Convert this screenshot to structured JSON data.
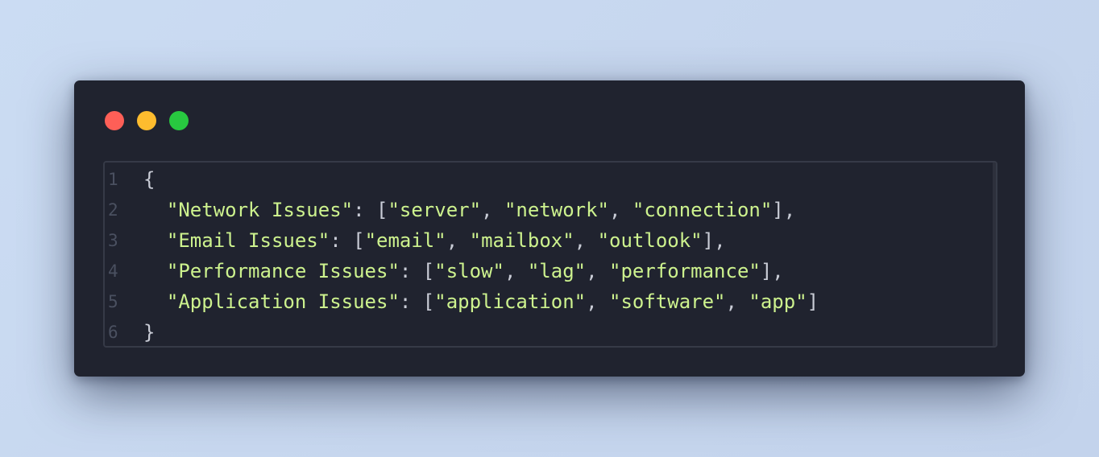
{
  "window": {
    "controls": {
      "close_color": "#fe5f57",
      "minimize_color": "#febc2e",
      "maximize_color": "#28c840"
    }
  },
  "editor": {
    "colors": {
      "background": "#20232f",
      "string": "#cdf28e",
      "punctuation": "#c9ccd6",
      "line_number": "#4a5060"
    },
    "lines": [
      {
        "number": "1",
        "open": "{"
      },
      {
        "number": "2",
        "indent": "  ",
        "key": "\"Network Issues\"",
        "sep": ": [",
        "values": [
          "\"server\"",
          "\"network\"",
          "\"connection\""
        ],
        "close": "],"
      },
      {
        "number": "3",
        "indent": "  ",
        "key": "\"Email Issues\"",
        "sep": ": [",
        "values": [
          "\"email\"",
          "\"mailbox\"",
          "\"outlook\""
        ],
        "close": "],"
      },
      {
        "number": "4",
        "indent": "  ",
        "key": "\"Performance Issues\"",
        "sep": ": [",
        "values": [
          "\"slow\"",
          "\"lag\"",
          "\"performance\""
        ],
        "close": "],"
      },
      {
        "number": "5",
        "indent": "  ",
        "key": "\"Application Issues\"",
        "sep": ": [",
        "values": [
          "\"application\"",
          "\"software\"",
          "\"app\""
        ],
        "close": "]"
      },
      {
        "number": "6",
        "open": "}"
      }
    ]
  }
}
